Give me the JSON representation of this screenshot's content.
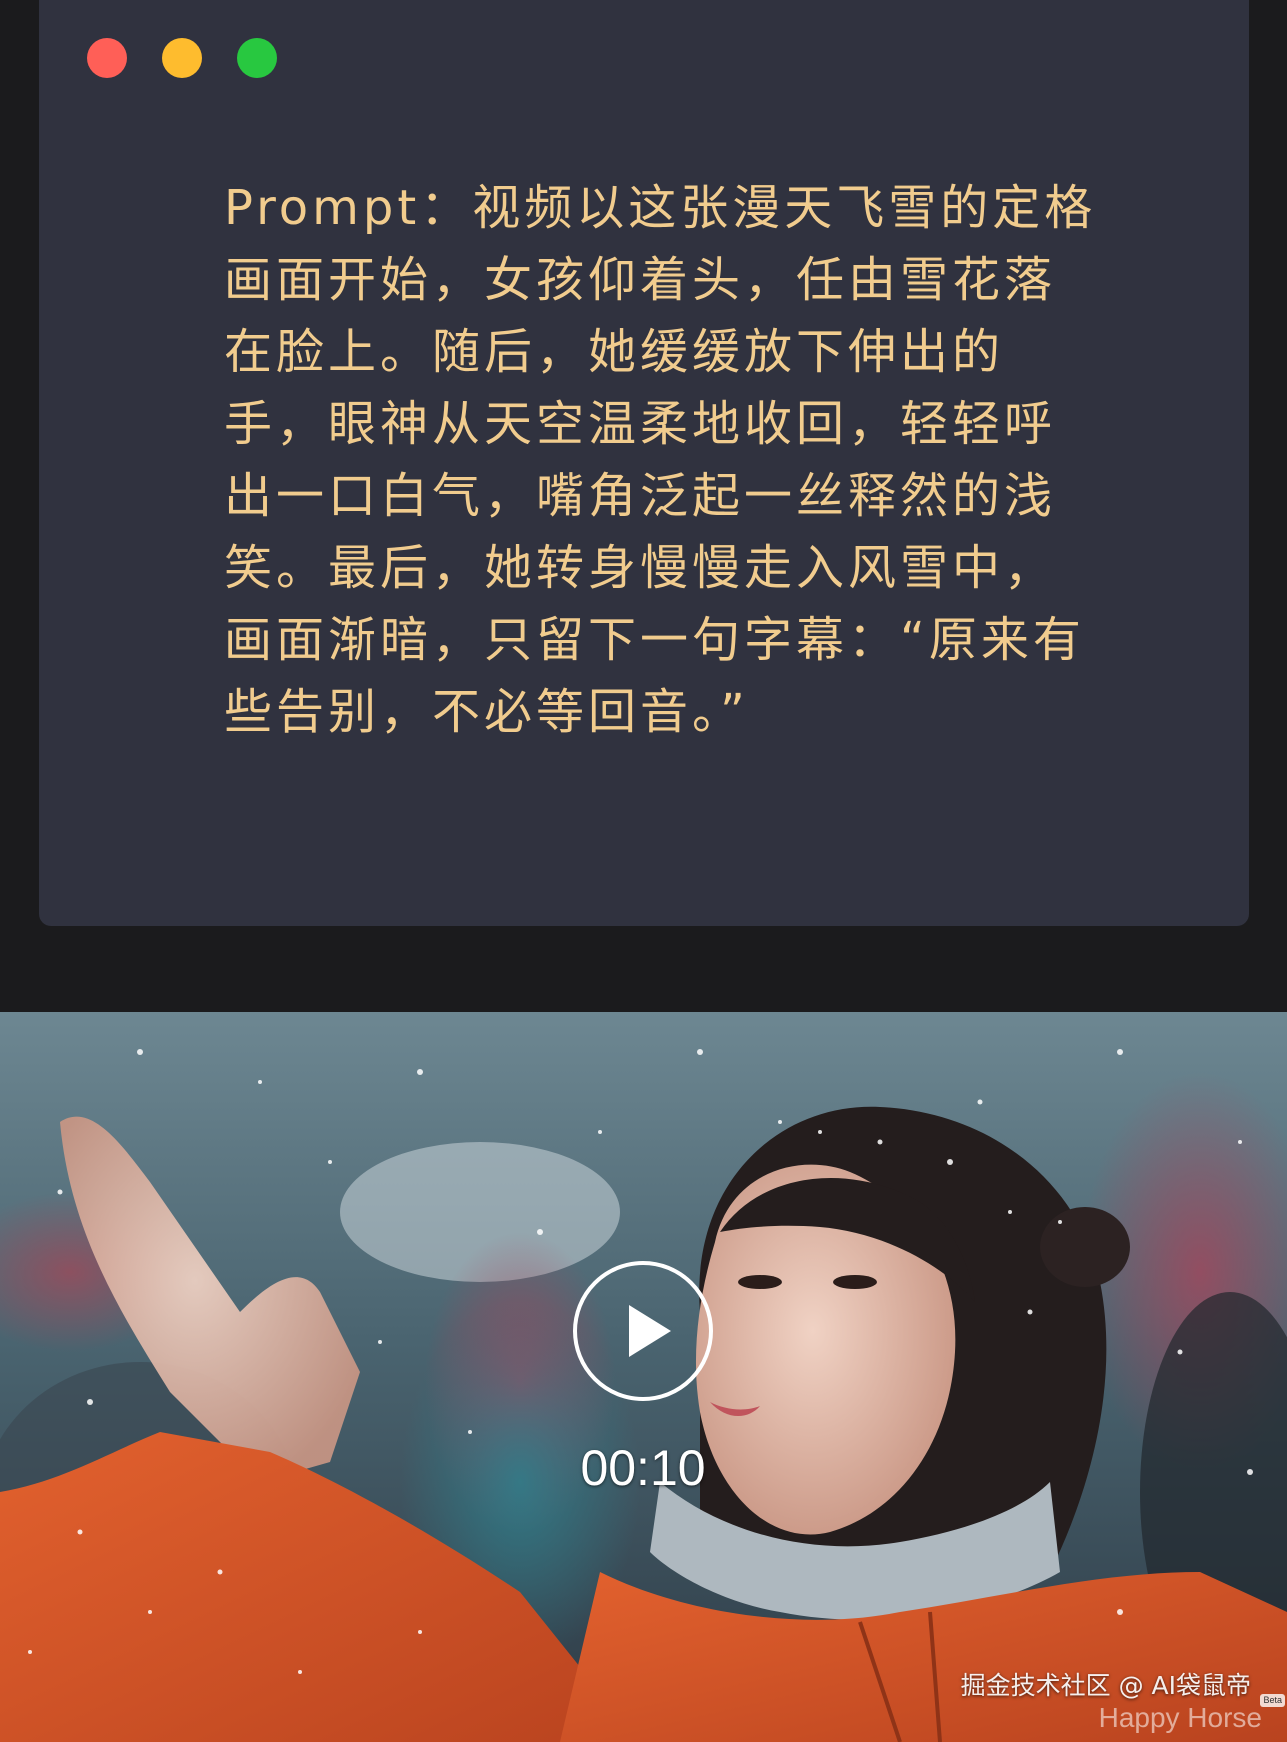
{
  "window": {
    "controls": [
      {
        "name": "close",
        "color": "#ff5f57"
      },
      {
        "name": "minimize",
        "color": "#febc2e"
      },
      {
        "name": "maximize",
        "color": "#28c840"
      }
    ]
  },
  "prompt": {
    "text": "Prompt：视频以这张漫天飞雪的定格画面开始，女孩仰着头，任由雪花落在脸上。随后，她缓缓放下伸出的手，眼神从天空温柔地收回，轻轻呼出一口白气，嘴角泛起一丝释然的浅笑。最后，她转身慢慢走入风雪中，画面渐暗，只留下一句字幕：“原来有些告别，不必等回音。”"
  },
  "video": {
    "play_icon": "play-icon",
    "duration": "00:10",
    "watermark": "掘金技术社区 @ AI袋鼠帝",
    "brand": "Happy Horse",
    "badge": "Beta"
  }
}
